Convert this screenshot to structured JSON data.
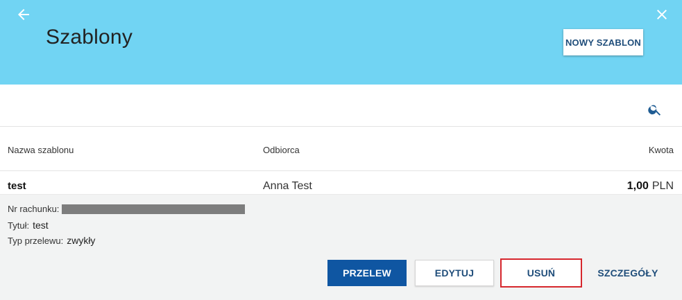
{
  "header": {
    "title": "Szablony",
    "new_template_label": "NOWY SZABLON",
    "icons": {
      "back": "arrow-left-icon",
      "close": "close-icon"
    },
    "background_color": "#71d4f3"
  },
  "search": {
    "value": "",
    "placeholder": "",
    "icon": "search-icon"
  },
  "table": {
    "columns": [
      "Nazwa szablonu",
      "Odbiorca",
      "Kwota"
    ],
    "rows": [
      {
        "name": "test",
        "recipient": "Anna Test",
        "amount": "1,00",
        "currency": "PLN",
        "details": {
          "account_label": "Nr rachunku:",
          "title_label": "Tytuł:",
          "title_value": "test",
          "type_label": "Typ przelewu:",
          "type_value": "zwykły"
        }
      }
    ]
  },
  "actions": {
    "transfer": "PRZELEW",
    "edit": "EDYTUJ",
    "delete": "USUŃ",
    "details": "SZCZEGÓŁY"
  },
  "colors": {
    "primary_button": "#0f56a2",
    "accent_text": "#1f4d7a",
    "highlight_border": "#d6262c"
  }
}
